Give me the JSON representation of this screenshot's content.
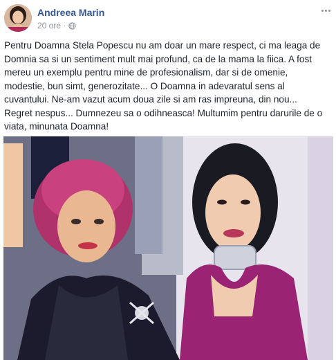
{
  "post": {
    "author": "Andreea Marin",
    "timestamp": "20 ore",
    "separator": "·",
    "audience_icon": "globe-icon",
    "more_icon": "more-options-icon",
    "text": "Pentru Doamna Stela Popescu nu am doar un mare respect, ci ma leaga de\nDomnia sa si un sentiment mult mai profund, ca de la mama la fiica. A fost\nmereu un exemplu pentru mine de profesionalism, dar si de omenie,\nmodestie, bun simt, generozitate... O Doamna in adevaratul sens al\ncuvantului. Ne-am vazut acum doua zile si am ras impreuna, din nou...\nRegret nespus... Dumnezeu sa o odihneasca! Multumim pentru darurile de o\nviata, minunata Doamna!"
  },
  "colors": {
    "author": "#365899",
    "meta": "#90949c",
    "text": "#1d2129"
  }
}
